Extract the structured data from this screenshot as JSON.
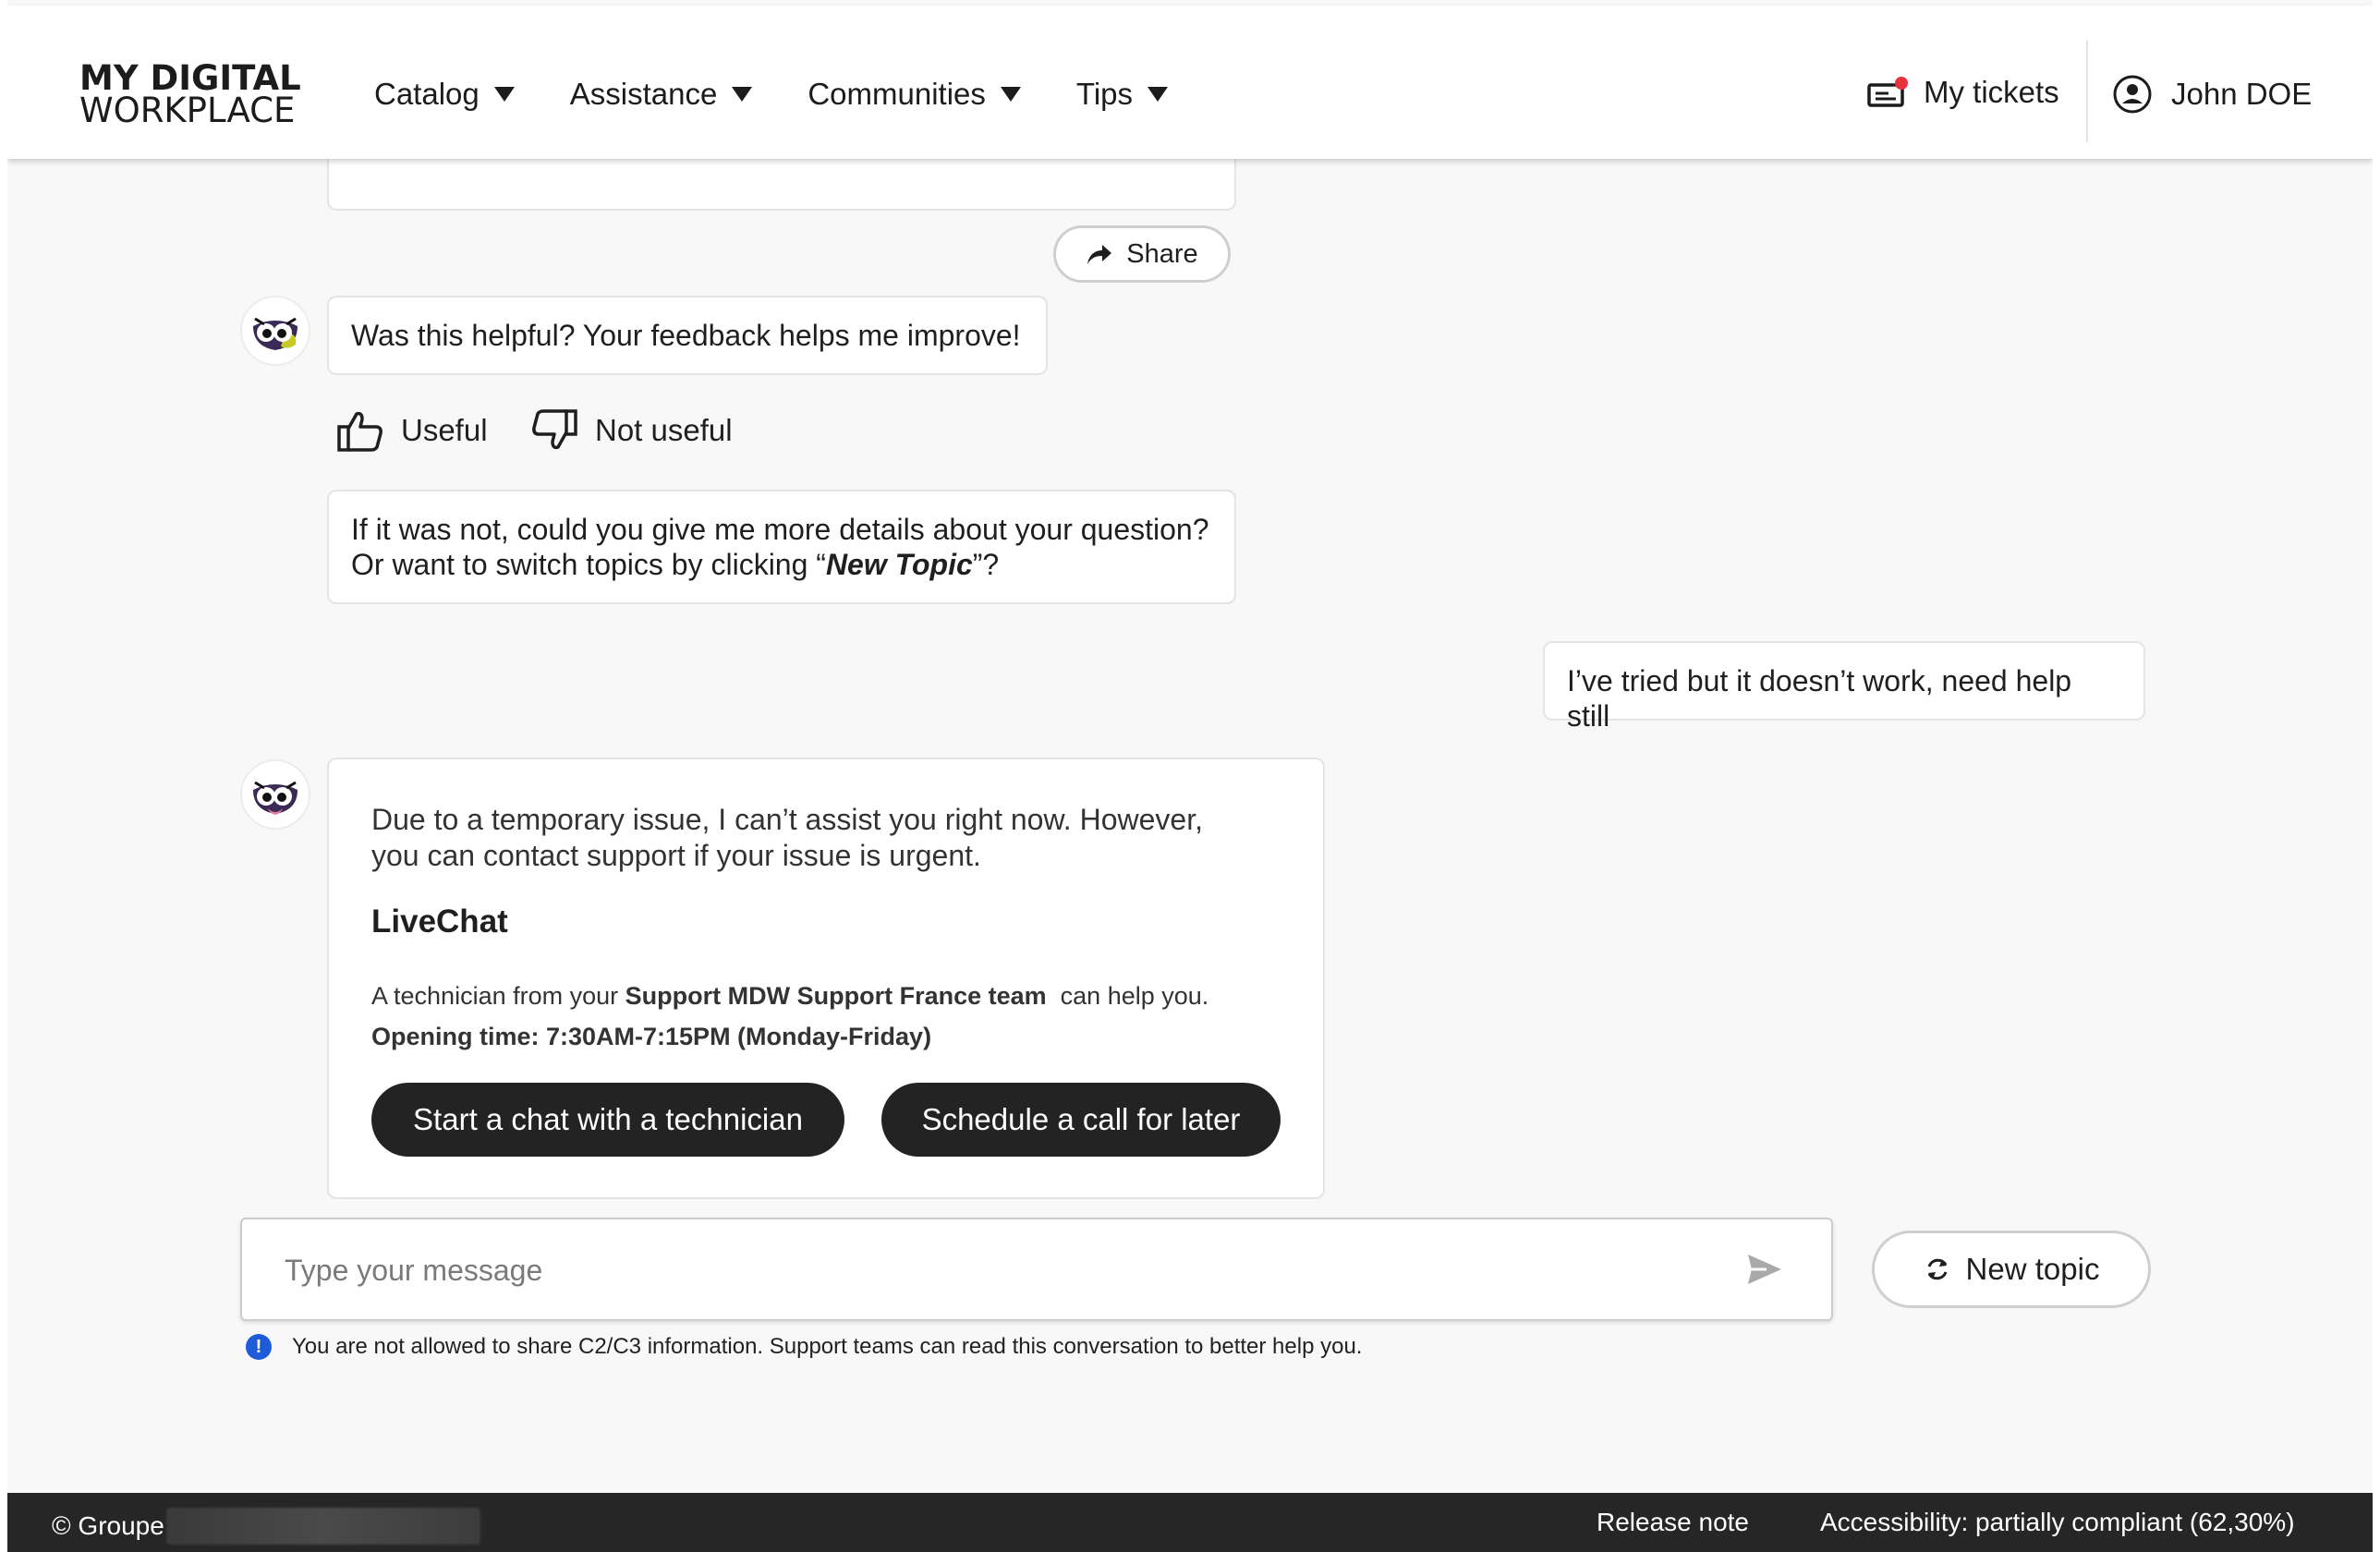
{
  "header": {
    "logo_line1": "MY DIGITAL",
    "logo_line2": "WORKPLACE",
    "nav": [
      {
        "label": "Catalog"
      },
      {
        "label": "Assistance"
      },
      {
        "label": "Communities"
      },
      {
        "label": "Tips"
      }
    ],
    "tickets_label": "My tickets",
    "user_name": "John DOE"
  },
  "chat": {
    "share_label": "Share",
    "feedback_question": "Was this helpful? Your feedback helps me improve!",
    "useful_label": "Useful",
    "not_useful_label": "Not useful",
    "followup_line1": "If it was not, could you give me more details about your question?",
    "followup_line2_prefix": "Or want to switch topics by clicking “",
    "followup_line2_emph": "New Topic",
    "followup_line2_suffix": "”?",
    "user_message": "I’ve tried but it doesn’t work, need help still",
    "support_line1": "Due to a temporary issue, I can’t assist you right now. However,",
    "support_line2": "you can contact support if your issue is urgent.",
    "livechat_title": "LiveChat",
    "tech_prefix": "A technician from your ",
    "tech_team": "Support MDW Support France team",
    "tech_suffix": "  can help you.",
    "opening_time": "Opening time: 7:30AM-7:15PM (Monday-Friday)",
    "start_chat_label": "Start a chat with a technician",
    "schedule_call_label": "Schedule a call for later"
  },
  "composer": {
    "placeholder": "Type your message",
    "value": "",
    "new_topic_label": "New topic",
    "notice": "You are not allowed to share C2/C3 information. Support teams can read this conversation to better help you."
  },
  "footer": {
    "copyright": "© Groupe",
    "release_note": "Release note",
    "accessibility": "Accessibility: partially compliant (62,30%)"
  },
  "colors": {
    "dark_button": "#232323",
    "notification_dot": "#e8323c",
    "info_blue": "#1e5bd8",
    "footer_bg": "#262626"
  }
}
